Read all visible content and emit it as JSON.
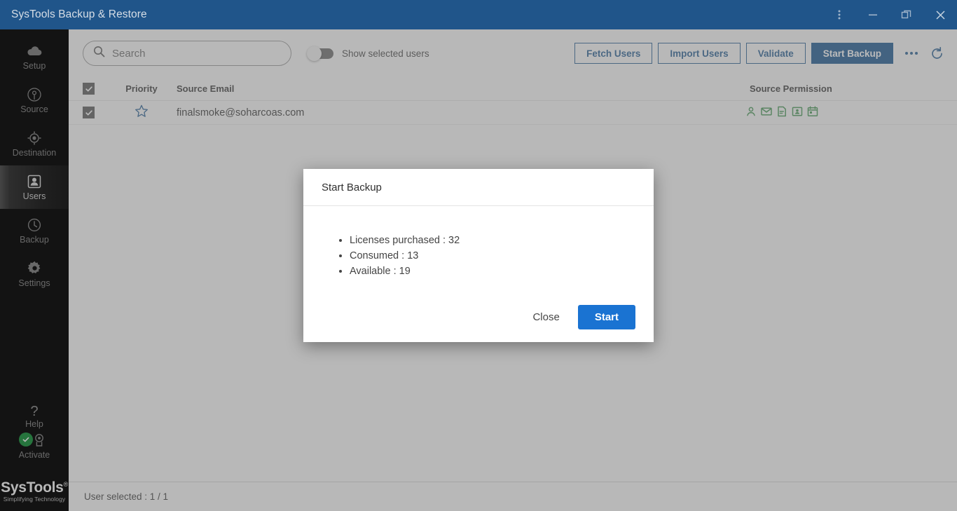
{
  "window": {
    "title": "SysTools Backup & Restore",
    "controls": [
      {
        "name": "more-menu",
        "icon": "vertical-dots-icon"
      },
      {
        "name": "minimize",
        "icon": "minimize-icon"
      },
      {
        "name": "restore",
        "icon": "restore-icon"
      },
      {
        "name": "close",
        "icon": "close-icon"
      }
    ],
    "titlebar_color": "#20558a"
  },
  "sidebar": {
    "items": [
      {
        "label": "Setup",
        "icon": "cloud-icon",
        "active": false
      },
      {
        "label": "Source",
        "icon": "antenna-icon",
        "active": false
      },
      {
        "label": "Destination",
        "icon": "target-icon",
        "active": false
      },
      {
        "label": "Users",
        "icon": "user-badge-icon",
        "active": true
      },
      {
        "label": "Backup",
        "icon": "clock-icon",
        "active": false
      },
      {
        "label": "Settings",
        "icon": "gear-icon",
        "active": false
      }
    ],
    "help": {
      "label": "Help",
      "icon": "question-mark-icon"
    },
    "activate": {
      "label": "Activate",
      "icon": "award-badge-icon",
      "status_icon": "green-check-icon",
      "status_color": "#2e9e4f"
    },
    "logo": {
      "name": "SysTools",
      "registered": "®",
      "tagline": "Simplifying Technology"
    }
  },
  "toolbar": {
    "search": {
      "value": "",
      "placeholder": "Search",
      "icon": "search-icon"
    },
    "toggle": {
      "label": "Show selected users",
      "checked": false
    },
    "buttons": [
      {
        "label": "Fetch Users",
        "style": "outline"
      },
      {
        "label": "Import Users",
        "style": "outline"
      },
      {
        "label": "Validate",
        "style": "outline"
      },
      {
        "label": "Start Backup",
        "style": "primary"
      }
    ],
    "more_icon": "ellipsis-icon",
    "refresh_icon": "refresh-icon",
    "accent_color": "#1e5a92"
  },
  "table": {
    "columns": [
      "Priority",
      "Source Email",
      "Source Permission"
    ],
    "header_checked": true,
    "permission_icons": [
      "person-icon",
      "mail-icon",
      "document-icon",
      "contact-card-icon",
      "calendar-icon"
    ],
    "permission_color": "#4a9a5a",
    "rows": [
      {
        "checked": true,
        "priority_icon": "star-outline-icon",
        "priority_color": "#2c6296",
        "email": "finalsmoke@soharcoas.com",
        "permissions": [
          "person-icon",
          "mail-icon",
          "document-icon",
          "contact-card-icon",
          "calendar-icon"
        ]
      }
    ]
  },
  "footer": {
    "status": "User selected : 1 / 1"
  },
  "modal": {
    "title": "Start Backup",
    "items": [
      "Licenses purchased : 32",
      "Consumed : 13",
      "Available : 19"
    ],
    "close_label": "Close",
    "start_label": "Start",
    "start_color": "#1a73d2"
  }
}
